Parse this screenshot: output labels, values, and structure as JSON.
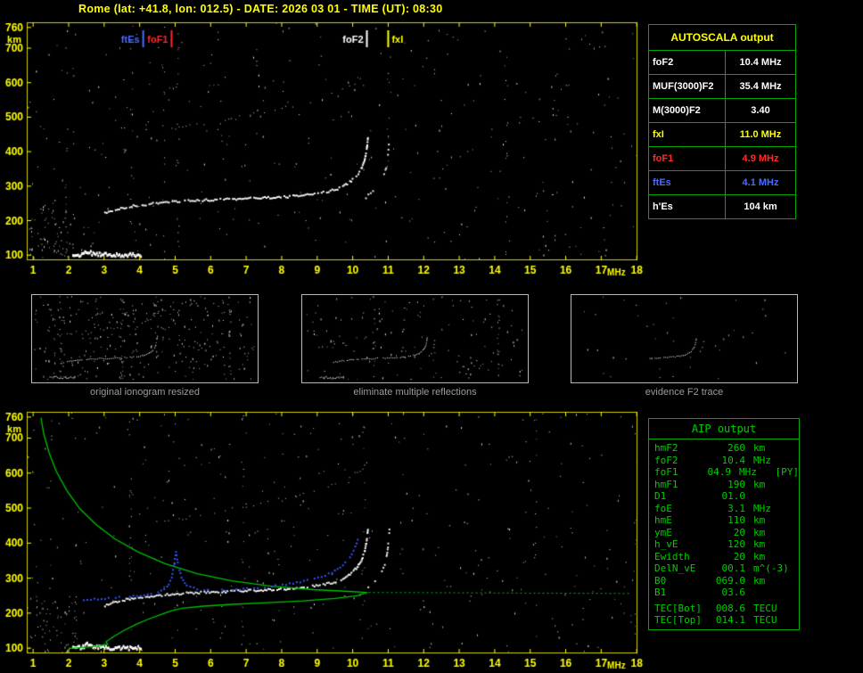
{
  "title": "Rome (lat: +41.8, lon: 012.5) - DATE: 2026 03 01 - TIME (UT): 08:30",
  "captions": [
    "original ionogram resized",
    "eliminate multiple reflections",
    "evidence F2 trace"
  ],
  "autoscala_table": {
    "header": "AUTOSCALA output",
    "rows": [
      {
        "label": "foF2",
        "value": "10.4 MHz",
        "color": "#ffffff"
      },
      {
        "label": "MUF(3000)F2",
        "value": "35.4 MHz",
        "color": "#ffffff"
      },
      {
        "label": "M(3000)F2",
        "value": "3.40",
        "color": "#ffffff"
      },
      {
        "label": "fxI",
        "value": "11.0 MHz",
        "color": "#ffff00"
      },
      {
        "label": "foF1",
        "value": "4.9 MHz",
        "color": "#ff2a2a"
      },
      {
        "label": "ftEs",
        "value": "4.1 MHz",
        "color": "#4a6cff"
      },
      {
        "label": "h'Es",
        "value": "104  km",
        "color": "#ffffff"
      }
    ]
  },
  "aip_table": {
    "header": "AIP output",
    "rows": [
      {
        "name": "hmF2",
        "value": "260",
        "unit": "km"
      },
      {
        "name": "foF2",
        "value": "10.4",
        "unit": "MHz"
      },
      {
        "name": "foF1",
        "value": "04.9",
        "unit": "MHz",
        "note": "[PY]"
      },
      {
        "name": "hmF1",
        "value": "190",
        "unit": "km"
      },
      {
        "name": "D1",
        "value": "01.0",
        "unit": ""
      },
      {
        "name": "foE",
        "value": "3.1",
        "unit": "MHz"
      },
      {
        "name": "hmE",
        "value": "110",
        "unit": "km"
      },
      {
        "name": "ymE",
        "value": "20",
        "unit": "km"
      },
      {
        "name": "h_vE",
        "value": "120",
        "unit": "km"
      },
      {
        "name": "Ewidth",
        "value": "20",
        "unit": "km"
      },
      {
        "name": "DelN_vE",
        "value": "00.1",
        "unit": "m^(-3)"
      },
      {
        "name": "B0",
        "value": "069.0",
        "unit": "km"
      },
      {
        "name": "B1",
        "value": "03.6",
        "unit": ""
      },
      {
        "name": "TEC[Bot]",
        "value": "008.6",
        "unit": "TECU",
        "gap": true
      },
      {
        "name": "TEC[Top]",
        "value": "014.1",
        "unit": "TECU"
      }
    ]
  },
  "chart_data": [
    {
      "id": "top-ionogram",
      "type": "scatter",
      "seed": 11,
      "xlabel": "MHz",
      "ylabel": "km",
      "xlim": [
        0.82,
        18.02
      ],
      "ylim": [
        85,
        775
      ],
      "xticks": [
        1,
        2,
        3,
        4,
        5,
        6,
        7,
        8,
        9,
        10,
        11,
        12,
        13,
        14,
        15,
        16,
        17,
        18
      ],
      "yticks": [
        760,
        700,
        600,
        500,
        400,
        300,
        200,
        100
      ],
      "axes": {
        "color": "#ffff00"
      },
      "frame": "#cfcf00",
      "margins": {
        "l": 30,
        "r": 10,
        "t": 3,
        "b": 22
      },
      "markers": [
        {
          "label": "ftEs",
          "freq": 4.1,
          "color": "#4a6cff",
          "side": "left"
        },
        {
          "label": "foF1",
          "freq": 4.9,
          "color": "#ff2a2a",
          "side": "left"
        },
        {
          "label": "foF2",
          "freq": 10.4,
          "color": "#ffffff",
          "side": "left"
        },
        {
          "label": "fxI",
          "freq": 11.0,
          "color": "#ffff00",
          "side": "right"
        }
      ],
      "series": [
        {
          "name": "es",
          "style": "thick",
          "color": "#ffffff",
          "points": [
            [
              2.1,
              103
            ],
            [
              2.35,
              104
            ],
            [
              2.5,
              114
            ],
            [
              2.7,
              106
            ],
            [
              3.1,
              104
            ],
            [
              3.6,
              104
            ],
            [
              4.05,
              105
            ]
          ]
        },
        {
          "name": "f2o",
          "style": "trace",
          "color": "#ffffff",
          "points": [
            [
              3.0,
              224
            ],
            [
              3.3,
              234
            ],
            [
              3.7,
              243
            ],
            [
              4.2,
              250
            ],
            [
              4.7,
              255
            ],
            [
              5.2,
              259
            ],
            [
              5.8,
              262
            ],
            [
              6.4,
              264
            ],
            [
              7.0,
              266
            ],
            [
              7.6,
              269
            ],
            [
              8.2,
              272
            ],
            [
              8.7,
              277
            ],
            [
              9.1,
              283
            ],
            [
              9.45,
              291
            ],
            [
              9.7,
              301
            ],
            [
              9.9,
              314
            ],
            [
              10.08,
              331
            ],
            [
              10.22,
              352
            ],
            [
              10.31,
              378
            ],
            [
              10.37,
              408
            ],
            [
              10.41,
              445
            ]
          ]
        },
        {
          "name": "f2x",
          "style": "trace-sparse",
          "color": "#e8e8e8",
          "points": [
            [
              10.35,
              270
            ],
            [
              10.55,
              287
            ],
            [
              10.72,
              307
            ],
            [
              10.84,
              330
            ],
            [
              10.92,
              358
            ],
            [
              10.97,
              392
            ],
            [
              11.0,
              428
            ],
            [
              11.02,
              455
            ]
          ]
        },
        {
          "name": "hop2",
          "style": "sparse",
          "color": "#c0c0c0",
          "points": [
            [
              4.6,
              462
            ],
            [
              5.3,
              474
            ],
            [
              6.0,
              487
            ],
            [
              6.8,
              501
            ],
            [
              7.6,
              517
            ],
            [
              8.4,
              536
            ],
            [
              9.0,
              553
            ],
            [
              9.5,
              570
            ],
            [
              9.9,
              589
            ],
            [
              10.2,
              608
            ],
            [
              10.35,
              622
            ]
          ]
        },
        {
          "name": "noise",
          "style": "noise",
          "count": 380
        },
        {
          "name": "noise-left",
          "style": "noise",
          "count": 70,
          "region": [
            0.82,
            85,
            2.2,
            250
          ]
        },
        {
          "name": "streaks",
          "style": "vstreaks",
          "count": 7
        }
      ]
    },
    {
      "id": "bottom-ionogram",
      "type": "scatter",
      "seed": 29,
      "xlabel": "MHz",
      "ylabel": "km",
      "xlim": [
        0.82,
        18.02
      ],
      "ylim": [
        85,
        775
      ],
      "xticks": [
        1,
        2,
        3,
        4,
        5,
        6,
        7,
        8,
        9,
        10,
        11,
        12,
        13,
        14,
        15,
        16,
        17,
        18
      ],
      "yticks": [
        760,
        700,
        600,
        500,
        400,
        300,
        200,
        100
      ],
      "axes": {
        "color": "#ffff00"
      },
      "frame": "#cfcf00",
      "margins": {
        "l": 30,
        "r": 10,
        "t": 7,
        "b": 22
      },
      "series_from": "top-ionogram",
      "include": [
        "es",
        "f2o",
        "f2x",
        "hop2"
      ],
      "series": [
        {
          "name": "noise",
          "style": "noise",
          "count": 380
        },
        {
          "name": "noise-left",
          "style": "noise",
          "count": 60,
          "region": [
            0.82,
            85,
            2.2,
            250
          ]
        },
        {
          "name": "streaks",
          "style": "vstreaks",
          "count": 6
        },
        {
          "name": "ne-profile",
          "style": "line",
          "color": "#00c000",
          "width": 1.3,
          "points": [
            [
              1.22,
              758
            ],
            [
              1.3,
              712
            ],
            [
              1.45,
              658
            ],
            [
              1.65,
              605
            ],
            [
              1.95,
              550
            ],
            [
              2.3,
              500
            ],
            [
              2.75,
              455
            ],
            [
              3.3,
              412
            ],
            [
              3.95,
              375
            ],
            [
              4.7,
              342
            ],
            [
              5.6,
              313
            ],
            [
              6.6,
              292
            ],
            [
              7.7,
              277
            ],
            [
              8.9,
              267
            ],
            [
              9.9,
              262
            ],
            [
              10.38,
              259
            ],
            [
              10.15,
              250
            ],
            [
              9.5,
              242
            ],
            [
              8.6,
              235
            ],
            [
              7.6,
              230
            ],
            [
              6.6,
              225
            ],
            [
              5.8,
              220
            ],
            [
              5.2,
              214
            ],
            [
              4.9,
              207
            ],
            [
              4.6,
              196
            ],
            [
              4.25,
              183
            ],
            [
              3.9,
              168
            ],
            [
              3.55,
              150
            ],
            [
              3.25,
              132
            ],
            [
              3.05,
              118
            ],
            [
              3.1,
              111
            ],
            [
              2.85,
              106
            ],
            [
              2.4,
              102
            ],
            [
              2.0,
              99
            ]
          ]
        },
        {
          "name": "ne-extrapolation",
          "style": "dotted",
          "color": "#00c000",
          "width": 1,
          "points": [
            [
              10.45,
              259
            ],
            [
              17.85,
              256
            ]
          ]
        },
        {
          "name": "calc-trace",
          "style": "dots",
          "color": "#3355ff",
          "points": [
            [
              2.4,
              240
            ],
            [
              3.0,
              244
            ],
            [
              3.6,
              249
            ],
            [
              4.1,
              254
            ],
            [
              4.5,
              261
            ],
            [
              4.75,
              277
            ],
            [
              4.88,
              305
            ],
            [
              4.95,
              345
            ],
            [
              5.0,
              378
            ],
            [
              5.05,
              345
            ],
            [
              5.15,
              305
            ],
            [
              5.3,
              283
            ],
            [
              5.6,
              271
            ],
            [
              6.0,
              267
            ],
            [
              6.5,
              268
            ],
            [
              7.0,
              272
            ],
            [
              7.5,
              277
            ],
            [
              8.0,
              283
            ],
            [
              8.5,
              292
            ],
            [
              9.0,
              303
            ],
            [
              9.4,
              318
            ],
            [
              9.7,
              338
            ],
            [
              9.9,
              362
            ],
            [
              10.05,
              392
            ],
            [
              10.15,
              425
            ]
          ]
        }
      ]
    },
    {
      "id": "mini-original",
      "type": "scatter",
      "seed": 3,
      "mini": true,
      "xlim": [
        0.82,
        18.02
      ],
      "ylim": [
        85,
        775
      ],
      "margins": {
        "l": 1,
        "r": 1,
        "t": 1,
        "b": 1
      },
      "series_from": "top-ionogram",
      "include": [
        "es",
        "f2o",
        "f2x",
        "hop2"
      ],
      "series": [
        {
          "name": "noise",
          "style": "noise",
          "count": 300
        },
        {
          "name": "streaks",
          "style": "vstreaks",
          "count": 6
        }
      ]
    },
    {
      "id": "mini-clean",
      "type": "scatter",
      "seed": 4,
      "mini": true,
      "xlim": [
        0.82,
        18.02
      ],
      "ylim": [
        85,
        775
      ],
      "margins": {
        "l": 1,
        "r": 1,
        "t": 1,
        "b": 1
      },
      "series_from": "top-ionogram",
      "include": [
        "es",
        "f2o",
        "f2x"
      ],
      "series": [
        {
          "name": "noise",
          "style": "noise",
          "count": 140
        },
        {
          "name": "streaks",
          "style": "vstreaks",
          "count": 3
        }
      ]
    },
    {
      "id": "mini-f2",
      "type": "scatter",
      "seed": 5,
      "mini": true,
      "xlim": [
        0.82,
        18.02
      ],
      "ylim": [
        85,
        775
      ],
      "margins": {
        "l": 1,
        "r": 1,
        "t": 1,
        "b": 1
      },
      "series": [
        {
          "name": "f2-evidence",
          "style": "trace",
          "color": "#ffffff",
          "points": [
            [
              6.8,
              266
            ],
            [
              7.6,
              269
            ],
            [
              8.3,
              273
            ],
            [
              8.9,
              280
            ],
            [
              9.4,
              290
            ],
            [
              9.75,
              304
            ],
            [
              10.0,
              322
            ],
            [
              10.18,
              346
            ],
            [
              10.3,
              375
            ],
            [
              10.37,
              410
            ],
            [
              10.41,
              445
            ]
          ]
        },
        {
          "name": "f2x-evidence",
          "style": "trace-sparse",
          "color": "#e8e8e8",
          "points": [
            [
              10.6,
              300
            ],
            [
              10.8,
              335
            ],
            [
              10.92,
              375
            ],
            [
              11.0,
              420
            ]
          ]
        },
        {
          "name": "noise",
          "style": "noise",
          "count": 40
        }
      ]
    }
  ]
}
